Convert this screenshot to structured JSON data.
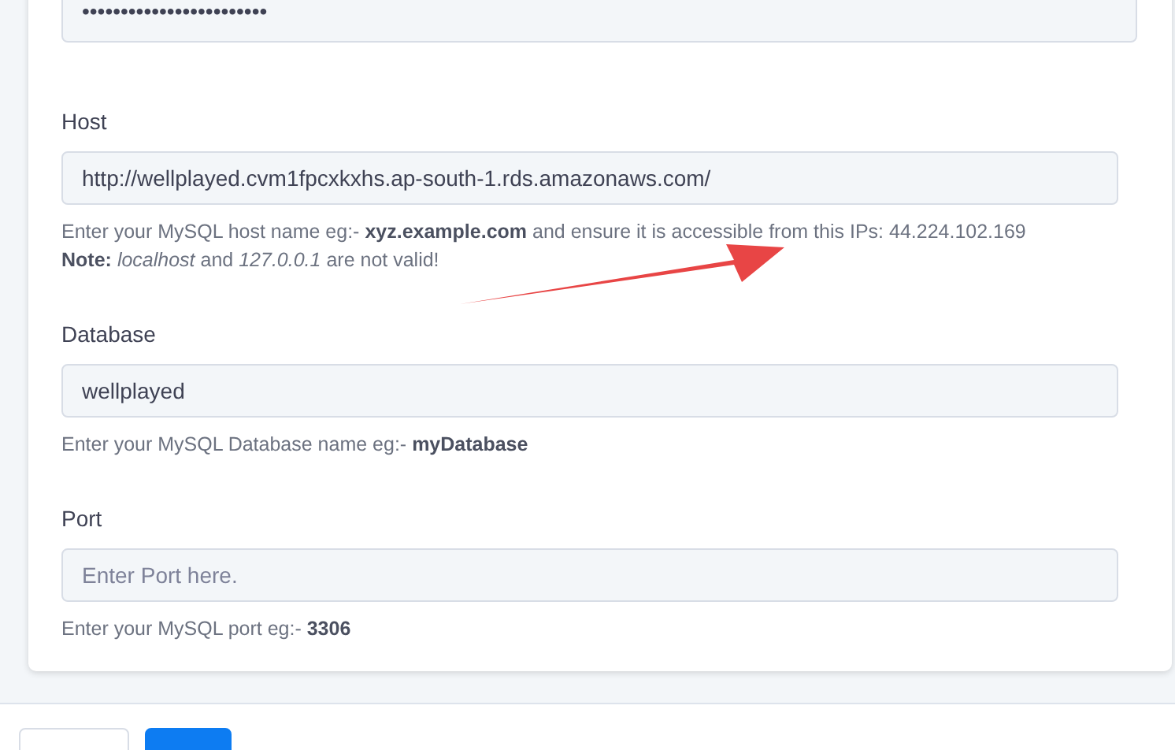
{
  "fields": [
    {
      "kind": "password",
      "value": "••••••••••••••••••••••••"
    },
    {
      "kind": "text",
      "label": "Host",
      "value": "http://wellplayed.cvm1fpcxkxhs.ap-south-1.rds.amazonaws.com/",
      "hints": [
        "Enter your MySQL host name eg:- **xyz.example.com** and ensure it is accessible from this IPs: 44.224.102.169",
        "**Note:** *localhost* and *127.0.0.1* are not valid!"
      ]
    },
    {
      "kind": "text",
      "label": "Database",
      "value": "wellplayed",
      "hints": [
        "Enter your MySQL Database name eg:- **myDatabase**"
      ]
    },
    {
      "kind": "text",
      "label": "Port",
      "placeholder": "Enter Port here.",
      "hints": [
        "Enter your MySQL port eg:- **3306**"
      ]
    }
  ],
  "footer_buttons": [
    {
      "kind": "outline"
    },
    {
      "kind": "primary"
    }
  ]
}
